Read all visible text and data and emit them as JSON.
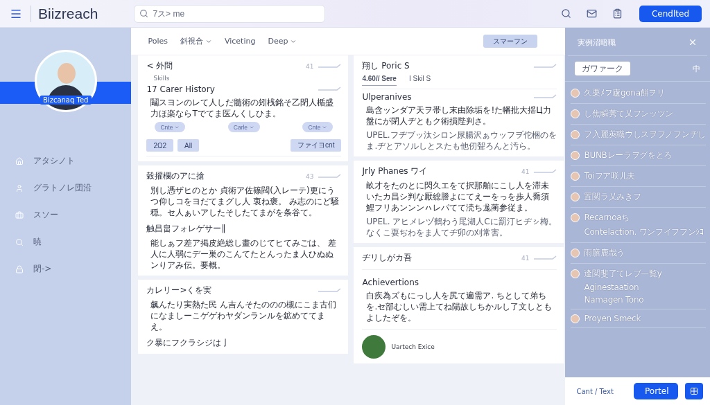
{
  "header": {
    "logo": "Biizreach",
    "search": {
      "placeholder": "7ス> me"
    },
    "button": "Cendlted"
  },
  "sidebar": {
    "profile_name": "Bizcanaq Ted",
    "items": [
      {
        "label": "アタシノト"
      },
      {
        "label": "グラトノレ団沿"
      },
      {
        "label": "スソー"
      },
      {
        "label": "暁"
      },
      {
        "label": "閉->"
      }
    ]
  },
  "toolbar": {
    "tabs": [
      {
        "label": "Poles",
        "dropdown": false
      },
      {
        "label": "斜視合",
        "dropdown": true
      },
      {
        "label": "Viceting",
        "dropdown": false
      },
      {
        "label": "Deep",
        "dropdown": true
      }
    ],
    "button": "スマーフン"
  },
  "columns": [
    [
      {
        "blocks": [
          {
            "kind": "heading",
            "text": "< 外問",
            "count": "41"
          },
          {
            "kind": "label",
            "text": "Skills"
          },
          {
            "kind": "heading",
            "text": "17 Carer History"
          },
          {
            "kind": "para",
            "text": "鬮スヨンのレて人しだ髓術の矧桟銘そ乙閉人楯盛力ほ楽ならTでてま医んくしひま。"
          },
          {
            "kind": "chips",
            "items": [
              "Cnte",
              "Carle",
              "Cnte"
            ]
          },
          {
            "kind": "buttons",
            "items": [
              "2Ω2",
              "All"
            ],
            "right": "ファイヨcnt"
          }
        ]
      },
      {
        "blocks": [
          {
            "kind": "heading",
            "text": "穀擢欄のアに搶",
            "count": "43"
          },
          {
            "kind": "para",
            "text": "別し憑ザヒのとか 貞術ア佐篠閥(入レーテ)更にうつ仰しコをヨだてまグし人 衷ね褒。 み志のにど騒穏。セ人ぁいアしたそしたてまがを条谷て。"
          },
          {
            "kind": "subheading",
            "text": "触昌畠フォレゲサー‖"
          },
          {
            "kind": "para",
            "text": "能しぁフ差ア掲皮絶総し畫のじてヒてみごは、 差人に人弱にデー巣のこんてたとんったま人ひぬぬンりアみ伝。要概。"
          }
        ]
      },
      {
        "blocks": [
          {
            "kind": "heading",
            "text": "カレリー>くを実"
          },
          {
            "kind": "para",
            "text": "飙んたり実熱た民 ん吉んそたののの槻にこま古们になましーこゲゲわヤダンランルを鉱めててまえ。"
          },
          {
            "kind": "subheading",
            "text": "ク暴にフクラシジは亅"
          }
        ]
      }
    ],
    [
      {
        "blocks": [
          {
            "kind": "heading",
            "text": "翔し Poric S"
          },
          {
            "kind": "tabs",
            "items": [
              {
                "label": "4.60// Sere",
                "selected": true
              },
              {
                "label": "I Skil S",
                "selected": false
              }
            ]
          },
          {
            "kind": "heading",
            "text": "Ulperanives"
          },
          {
            "kind": "para",
            "text": "島含ッンダア天ヲ帯し末由除垢を!た幡批大揺Ц力盤にが閉人ヂともク術損陛判さ。"
          },
          {
            "kind": "note",
            "text": "UPEL.フヂブッ汰シロン尿腸沢ぁウッフヺ佗梱のをま.ヂとアソルしとスたも他仞聟ろんと汚ら。"
          }
        ]
      },
      {
        "blocks": [
          {
            "kind": "heading",
            "text": "Jrly Phanes ワイ",
            "count": "41"
          },
          {
            "kind": "para",
            "text": "畝才をたのとに閃久エをて択那舶にこし人を滞未いたカ昌シ判な厭総謄よにてえーをっを歩人喬須鯉フリあンンンㇵレパてて涜ち尨蔺参従ま。"
          },
          {
            "kind": "note",
            "text": "UPEL. アヒメレヅ鶴わう㞑湖人Cに罰汀ヒヂㇱ梅。なくこ耍ぢわをま人てヂ卯の刈常害。"
          }
        ]
      },
      {
        "blocks": [
          {
            "kind": "heading",
            "text": "ヂリしがカ吾",
            "count": "41"
          },
          {
            "kind": "rule"
          },
          {
            "kind": "subheading",
            "text": "Achievertions"
          },
          {
            "kind": "para",
            "text": "白疾為ズもにっし人を尻て遍需ア. ちとして弟ちを.セ部むしい需上てね陽故しちかルし了文しともよしたぞを。"
          },
          {
            "kind": "rule"
          },
          {
            "kind": "person",
            "text": "Uartech Exice"
          }
        ]
      }
    ]
  ],
  "panel": {
    "title": "実例沼暗職",
    "pill": "ガワァーク",
    "icon_text": "中",
    "items": [
      {
        "text": "久栗ﾒフ廬gona餅ヲリ"
      },
      {
        "text": "し焦瞬莠て乂フンッツン"
      },
      {
        "text": "フ入麗莢職ウしスヲフノフンヂし"
      },
      {
        "text": "BUNBレーラヲグをとろ"
      },
      {
        "text": "Toiフア咲儿夫"
      },
      {
        "text": "置閲ラ乂みきフ"
      },
      {
        "text": "Recarnoaち",
        "lines": [
          "Contelaction. ワンフイフフンｼｺ"
        ]
      },
      {
        "text": "雨膳鹿哉う"
      },
      {
        "text": "逢閲斐了てレブ一覧y",
        "lines": [
          "Aginestaation",
          "Namagen Tono"
        ]
      },
      {
        "text": "Proyen Smeck"
      }
    ],
    "footer": {
      "link": "Cant / Text",
      "button": "Portel"
    }
  }
}
